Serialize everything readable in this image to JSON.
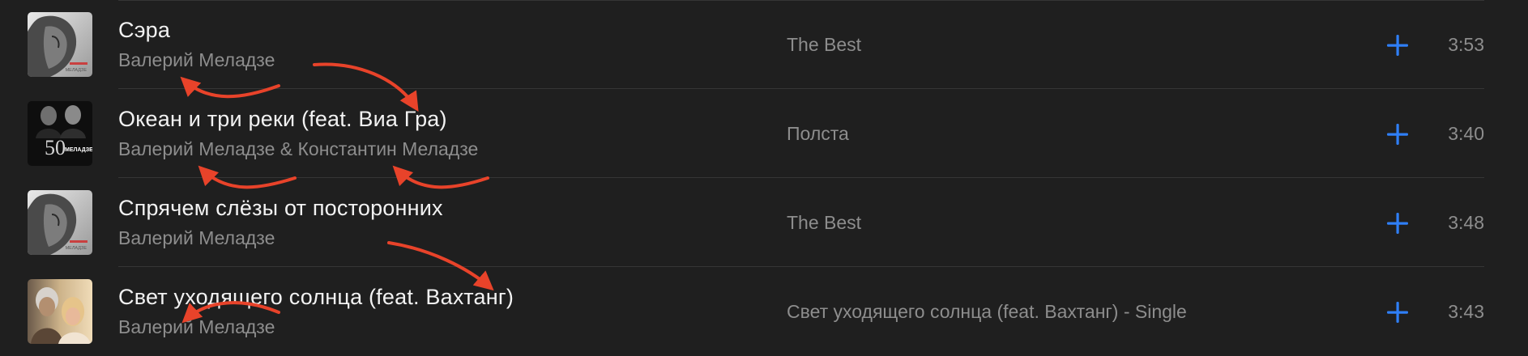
{
  "tracks": [
    {
      "title": "Сэра",
      "artist": "Валерий Меладзе",
      "album": "The Best",
      "duration": "3:53",
      "artwork_icon": "album-cover-the-best"
    },
    {
      "title": "Океан и три реки (feat. Виа Гра)",
      "artist": "Валерий Меладзе & Константин Меладзе",
      "album": "Полста",
      "duration": "3:40",
      "artwork_icon": "album-cover-polsta"
    },
    {
      "title": "Спрячем слёзы от посторонних",
      "artist": "Валерий Меладзе",
      "album": "The Best",
      "duration": "3:48",
      "artwork_icon": "album-cover-the-best"
    },
    {
      "title": "Свет уходящего солнца (feat. Вахтанг)",
      "artist": "Валерий Меладзе",
      "album": "Свет уходящего солнца (feat. Вахтанг) - Single",
      "duration": "3:43",
      "artwork_icon": "album-cover-single"
    }
  ],
  "art_text": {
    "cover_logo": "МЕЛАДЗЕ",
    "polsta_number": "50"
  },
  "add_icon": "plus-icon",
  "colors": {
    "background": "#1f1f1f",
    "title": "#f2f2f2",
    "secondary": "#8d8d8d",
    "accent": "#2f7ff7",
    "annotation": "#e8432a",
    "separator": "#353535"
  }
}
